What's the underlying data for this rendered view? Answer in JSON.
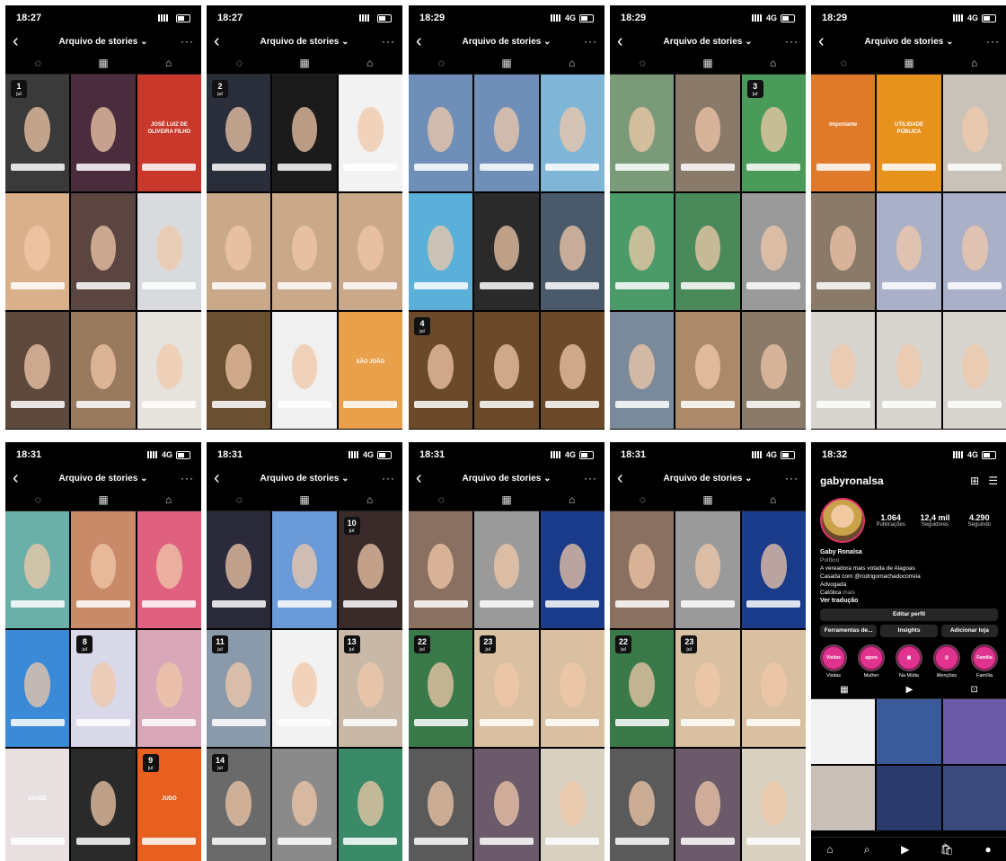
{
  "archive": {
    "title": "Arquivo de stories ⌄",
    "back_icon": "‹",
    "more_icon": "···",
    "tab_icons": [
      "◌",
      "▦",
      "⌂"
    ]
  },
  "screens_top": [
    {
      "time": "18:27",
      "signal": "",
      "tiles": [
        {
          "c": "#3a3a3a",
          "badge": "1",
          "badge_sub": "jul"
        },
        {
          "c": "#4a2c3c"
        },
        {
          "c": "#c9392b",
          "text": "JOSÉ LUIZ DE OLIVEIRA FILHO"
        },
        {
          "c": "#d9b08a"
        },
        {
          "c": "#5b4540"
        },
        {
          "c": "#d8dadd"
        },
        {
          "c": "#5e4a3c"
        },
        {
          "c": "#9a7a5e"
        },
        {
          "c": "#e6e2de"
        }
      ]
    },
    {
      "time": "18:27",
      "signal": "",
      "tiles": [
        {
          "c": "#2a2d3a",
          "badge": "2",
          "badge_sub": "jul"
        },
        {
          "c": "#1b1b1b"
        },
        {
          "c": "#f2f2f2"
        },
        {
          "c": "#c9a98a"
        },
        {
          "c": "#c9a98a"
        },
        {
          "c": "#c9a98a"
        },
        {
          "c": "#6a5030"
        },
        {
          "c": "#f0f0f0"
        },
        {
          "c": "#e9a04a",
          "text": "SÃO JOÃO"
        }
      ]
    },
    {
      "time": "18:29",
      "signal": "4G",
      "tiles": [
        {
          "c": "#6f8fb8"
        },
        {
          "c": "#6f8fb8"
        },
        {
          "c": "#7fb6d8"
        },
        {
          "c": "#5ab0d8"
        },
        {
          "c": "#2a2a2a"
        },
        {
          "c": "#4a5a6a"
        },
        {
          "c": "#6b4a2a",
          "badge": "4",
          "badge_sub": "jul"
        },
        {
          "c": "#6b4a2a"
        },
        {
          "c": "#6b4a2a"
        }
      ]
    },
    {
      "time": "18:29",
      "signal": "4G",
      "tiles": [
        {
          "c": "#7a9a7a"
        },
        {
          "c": "#8a7a6a"
        },
        {
          "c": "#4a9a5a",
          "badge": "3",
          "badge_sub": "jul"
        },
        {
          "c": "#4a9a6a"
        },
        {
          "c": "#4a8a5a"
        },
        {
          "c": "#9a9a9a"
        },
        {
          "c": "#7a8a9a"
        },
        {
          "c": "#aa8a6a"
        },
        {
          "c": "#8a7a6a"
        }
      ]
    },
    {
      "time": "18:29",
      "signal": "4G",
      "tiles": [
        {
          "c": "#e07a2a",
          "text": "Importante"
        },
        {
          "c": "#e8921e",
          "text": "UTILIDADE PÚBLICA"
        },
        {
          "c": "#c9c2b8"
        },
        {
          "c": "#8a7a6a"
        },
        {
          "c": "#aab0c8"
        },
        {
          "c": "#aab0c8"
        },
        {
          "c": "#d8d4d0"
        },
        {
          "c": "#d8d4d0"
        },
        {
          "c": "#d8d4d0"
        }
      ]
    }
  ],
  "screens_bottom": [
    {
      "time": "18:31",
      "signal": "4G",
      "tiles": [
        {
          "c": "#6ab0a8"
        },
        {
          "c": "#c98a6a"
        },
        {
          "c": "#e06080"
        },
        {
          "c": "#3a8ad8"
        },
        {
          "c": "#d8d8e8",
          "badge": "8",
          "badge_sub": "jul"
        },
        {
          "c": "#d8a8b8"
        },
        {
          "c": "#e8e0e0",
          "text": "SAÚDE"
        },
        {
          "c": "#2a2a2a"
        },
        {
          "c": "#e86020",
          "badge": "9",
          "badge_sub": "jul",
          "text": "JUDO"
        }
      ]
    },
    {
      "time": "18:31",
      "signal": "4G",
      "tiles": [
        {
          "c": "#2a2a3a"
        },
        {
          "c": "#6a9ad8"
        },
        {
          "c": "#3a2a2a",
          "badge": "10",
          "badge_sub": "jul"
        },
        {
          "c": "#8a9aaa",
          "badge": "11",
          "badge_sub": "jul"
        },
        {
          "c": "#f2f2f2"
        },
        {
          "c": "#c8b8a8",
          "badge": "13",
          "badge_sub": "jul"
        },
        {
          "c": "#6a6a6a",
          "badge": "14",
          "badge_sub": "jul"
        },
        {
          "c": "#8a8a8a"
        },
        {
          "c": "#3a8a6a"
        }
      ]
    },
    {
      "time": "18:31",
      "signal": "4G",
      "tiles": [
        {
          "c": "#8a7060"
        },
        {
          "c": "#9a9a9a"
        },
        {
          "c": "#1a3a8a"
        },
        {
          "c": "#3a7a4a",
          "badge": "22",
          "badge_sub": "jul"
        },
        {
          "c": "#d8c0a0",
          "badge": "23",
          "badge_sub": "jul"
        },
        {
          "c": "#d8c0a0"
        },
        {
          "c": "#5a5a5a"
        },
        {
          "c": "#6a5a6a"
        },
        {
          "c": "#d8d0c0"
        }
      ]
    },
    {
      "time": "18:31",
      "signal": "4G",
      "tiles": [
        {
          "c": "#8a7060"
        },
        {
          "c": "#9a9a9a"
        },
        {
          "c": "#1a3a8a"
        },
        {
          "c": "#3a7a4a",
          "badge": "22",
          "badge_sub": "jul"
        },
        {
          "c": "#d8c0a0",
          "badge": "23",
          "badge_sub": "jul"
        },
        {
          "c": "#d8c0a0"
        },
        {
          "c": "#5a5a5a"
        },
        {
          "c": "#6a5a6a"
        },
        {
          "c": "#d8d0c0"
        }
      ]
    }
  ],
  "profile": {
    "time": "18:32",
    "signal": "4G",
    "username": "gabyronalsa",
    "header_icons": [
      "⊞",
      "☰"
    ],
    "posts_count": "1.064",
    "posts_label": "Publicações",
    "followers_count": "12,4 mil",
    "followers_label": "Seguidores",
    "following_count": "4.290",
    "following_label": "Seguindo",
    "name": "Gaby Ronalsa",
    "category": "Político",
    "bio_1": "A vereadora mais votada de Alagoas",
    "bio_2": "Casada com @rodrigomachadocorreia",
    "bio_3": "Advogada",
    "bio_4": "Católica",
    "bio_more": "mais",
    "translate": "Ver tradução",
    "edit_profile": "Editar perfil",
    "tools": "Ferramentas de...",
    "insights": "Insights",
    "add_shop": "Adicionar loja",
    "highlights": [
      {
        "label": "Visitas",
        "inner": "Visitas"
      },
      {
        "label": "Mulher",
        "inner": "agora"
      },
      {
        "label": "Na Mídia",
        "inner": "▣"
      },
      {
        "label": "Menções",
        "inner": "@"
      },
      {
        "label": "Família",
        "inner": "Família"
      }
    ],
    "tab_icons": [
      "▦",
      "▶",
      "⊡"
    ],
    "nav_icons": [
      "⌂",
      "⌕",
      "▶",
      "🛍",
      "●"
    ],
    "grid_colors": [
      "#f2f2f2",
      "#3a5a9a",
      "#6a5aa8",
      "#c8c0b8",
      "#2a3a6a",
      "#3a4a7a"
    ]
  }
}
